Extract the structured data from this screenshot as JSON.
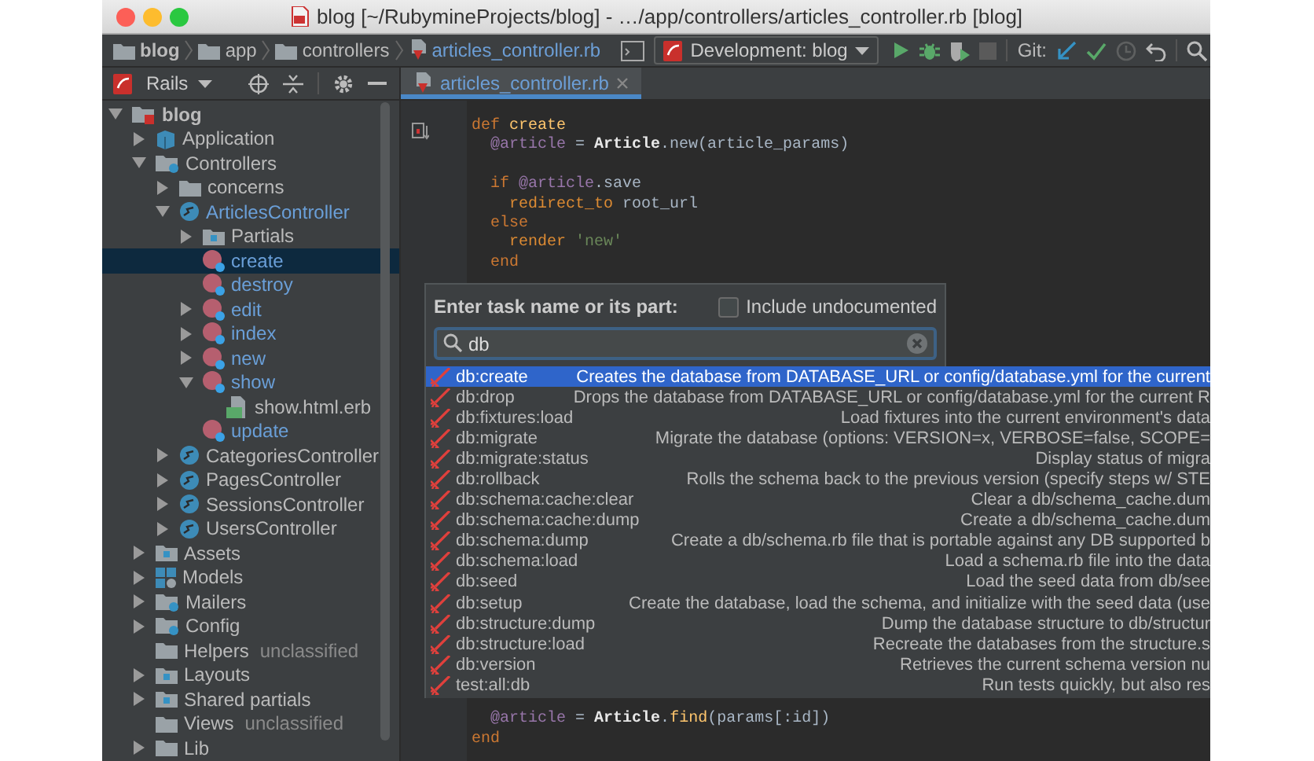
{
  "window": {
    "title": "blog [~/RubymineProjects/blog] - …/app/controllers/articles_controller.rb [blog]"
  },
  "breadcrumbs": [
    {
      "label": "blog",
      "kind": "project"
    },
    {
      "label": "app",
      "kind": "folder"
    },
    {
      "label": "controllers",
      "kind": "folder"
    },
    {
      "label": "articles_controller.rb",
      "kind": "file"
    }
  ],
  "run_config": {
    "label": "Development: blog"
  },
  "git_label": "Git:",
  "tool_window": {
    "title": "Rails"
  },
  "tree": [
    {
      "label": "blog",
      "kind": "project",
      "expanded": true,
      "current": false,
      "selected": false,
      "children": [
        {
          "label": "Application",
          "kind": "module",
          "expanded": false,
          "current": false,
          "selected": false
        },
        {
          "label": "Controllers",
          "kind": "folder-badge",
          "expanded": true,
          "current": false,
          "selected": false,
          "children": [
            {
              "label": "concerns",
              "kind": "folder",
              "expanded": false,
              "current": false,
              "selected": false
            },
            {
              "label": "ArticlesController",
              "kind": "controller",
              "expanded": true,
              "current": true,
              "selected": false,
              "children": [
                {
                  "label": "Partials",
                  "kind": "folder-special",
                  "expanded": false,
                  "current": false,
                  "selected": false
                },
                {
                  "label": "create",
                  "kind": "method",
                  "current": true,
                  "selected": true
                },
                {
                  "label": "destroy",
                  "kind": "method",
                  "current": true,
                  "selected": false
                },
                {
                  "label": "edit",
                  "kind": "method",
                  "expanded": false,
                  "current": true,
                  "selected": false
                },
                {
                  "label": "index",
                  "kind": "method",
                  "expanded": false,
                  "current": true,
                  "selected": false
                },
                {
                  "label": "new",
                  "kind": "method",
                  "expanded": false,
                  "current": true,
                  "selected": false
                },
                {
                  "label": "show",
                  "kind": "method",
                  "expanded": true,
                  "current": true,
                  "selected": false,
                  "children": [
                    {
                      "label": "show.html.erb",
                      "kind": "template",
                      "current": false,
                      "selected": false
                    }
                  ]
                },
                {
                  "label": "update",
                  "kind": "method",
                  "current": true,
                  "selected": false
                }
              ]
            },
            {
              "label": "CategoriesController",
              "kind": "controller",
              "expanded": false,
              "current": false,
              "selected": false
            },
            {
              "label": "PagesController",
              "kind": "controller",
              "expanded": false,
              "current": false,
              "selected": false
            },
            {
              "label": "SessionsController",
              "kind": "controller",
              "expanded": false,
              "current": false,
              "selected": false
            },
            {
              "label": "UsersController",
              "kind": "controller",
              "expanded": false,
              "current": false,
              "selected": false
            }
          ]
        },
        {
          "label": "Assets",
          "kind": "folder-special",
          "expanded": false,
          "current": false,
          "selected": false
        },
        {
          "label": "Models",
          "kind": "models",
          "expanded": false,
          "current": false,
          "selected": false
        },
        {
          "label": "Mailers",
          "kind": "folder-badge",
          "expanded": false,
          "current": false,
          "selected": false
        },
        {
          "label": "Config",
          "kind": "folder-badge",
          "expanded": false,
          "current": false,
          "selected": false
        },
        {
          "label": "Helpers",
          "note": "unclassified",
          "kind": "folder",
          "current": false,
          "selected": false
        },
        {
          "label": "Layouts",
          "kind": "folder-special",
          "expanded": false,
          "current": false,
          "selected": false
        },
        {
          "label": "Shared partials",
          "kind": "folder-special",
          "expanded": false,
          "current": false,
          "selected": false
        },
        {
          "label": "Views",
          "note": "unclassified",
          "kind": "folder",
          "current": false,
          "selected": false
        },
        {
          "label": "Lib",
          "kind": "folder",
          "expanded": false,
          "current": false,
          "selected": false
        }
      ]
    }
  ],
  "editor_tabs": [
    {
      "label": "articles_controller.rb",
      "selected": true
    }
  ],
  "code_top": [
    {
      "kind": "code",
      "tokens": [
        {
          "kind": "keyword",
          "text": "def"
        },
        {
          "kind": "function",
          "text": " create"
        }
      ],
      "children": [
        {
          "kind": "code",
          "tokens": [
            {
              "kind": "ivar",
              "text": "@article"
            },
            {
              "kind": "plain",
              "text": " = "
            },
            {
              "kind": "constant",
              "text": "Article"
            },
            {
              "kind": "plain",
              "text": ".new(article_params)"
            }
          ]
        },
        {
          "kind": "blank"
        },
        {
          "kind": "code",
          "tokens": [
            {
              "kind": "keyword",
              "text": "if"
            },
            {
              "kind": "ivar",
              "text": " @article"
            },
            {
              "kind": "plain",
              "text": ".save"
            }
          ],
          "children": [
            {
              "kind": "code",
              "tokens": [
                {
                  "kind": "call",
                  "text": "redirect_to"
                },
                {
                  "kind": "plain",
                  "text": " root_url"
                }
              ]
            }
          ]
        },
        {
          "kind": "code",
          "tokens": [
            {
              "kind": "keyword",
              "text": "else"
            }
          ],
          "children": [
            {
              "kind": "code",
              "tokens": [
                {
                  "kind": "call",
                  "text": "render"
                },
                {
                  "kind": "string",
                  "text": " 'new'"
                }
              ]
            }
          ]
        },
        {
          "kind": "code",
          "tokens": [
            {
              "kind": "keyword",
              "text": "end"
            }
          ]
        }
      ]
    }
  ],
  "code_bottom": {
    "body": [
      {
        "kind": "code",
        "tokens": [
          {
            "kind": "ivar",
            "text": "@article"
          },
          {
            "kind": "plain",
            "text": " = "
          },
          {
            "kind": "constant",
            "text": "Article"
          },
          {
            "kind": "plain",
            "text": "."
          },
          {
            "kind": "function",
            "text": "find"
          },
          {
            "kind": "plain",
            "text": "(params[:id])"
          }
        ]
      }
    ],
    "end_line": {
      "kind": "code",
      "tokens": [
        {
          "kind": "keyword",
          "text": "end"
        }
      ]
    }
  },
  "task_popup": {
    "prompt": "Enter task name or its part:",
    "include_undocumented": {
      "label": "Include undocumented",
      "checked": false
    },
    "search": {
      "value": "db"
    },
    "tasks": [
      {
        "name": "db:create",
        "description": "Creates the database from DATABASE_URL or config/database.yml for the current",
        "selected": true
      },
      {
        "name": "db:drop",
        "description": "Drops the database from DATABASE_URL or config/database.yml for the current R",
        "selected": false
      },
      {
        "name": "db:fixtures:load",
        "description": "Load fixtures into the current environment's data",
        "selected": false
      },
      {
        "name": "db:migrate",
        "description": "Migrate the database (options: VERSION=x, VERBOSE=false, SCOPE=",
        "selected": false
      },
      {
        "name": "db:migrate:status",
        "description": "Display status of migra",
        "selected": false
      },
      {
        "name": "db:rollback",
        "description": "Rolls the schema back to the previous version (specify steps w/ STE",
        "selected": false
      },
      {
        "name": "db:schema:cache:clear",
        "description": "Clear a db/schema_cache.dum",
        "selected": false
      },
      {
        "name": "db:schema:cache:dump",
        "description": "Create a db/schema_cache.dum",
        "selected": false
      },
      {
        "name": "db:schema:dump",
        "description": "Create a db/schema.rb file that is portable against any DB supported b",
        "selected": false
      },
      {
        "name": "db:schema:load",
        "description": "Load a schema.rb file into the data",
        "selected": false
      },
      {
        "name": "db:seed",
        "description": "Load the seed data from db/see",
        "selected": false
      },
      {
        "name": "db:setup",
        "description": "Create the database, load the schema, and initialize with the seed data (use",
        "selected": false
      },
      {
        "name": "db:structure:dump",
        "description": "Dump the database structure to db/structur",
        "selected": false
      },
      {
        "name": "db:structure:load",
        "description": "Recreate the databases from the structure.s",
        "selected": false
      },
      {
        "name": "db:version",
        "description": "Retrieves the current schema version nu",
        "selected": false
      },
      {
        "name": "test:all:db",
        "description": "Run tests quickly, but also res",
        "selected": false
      }
    ]
  }
}
